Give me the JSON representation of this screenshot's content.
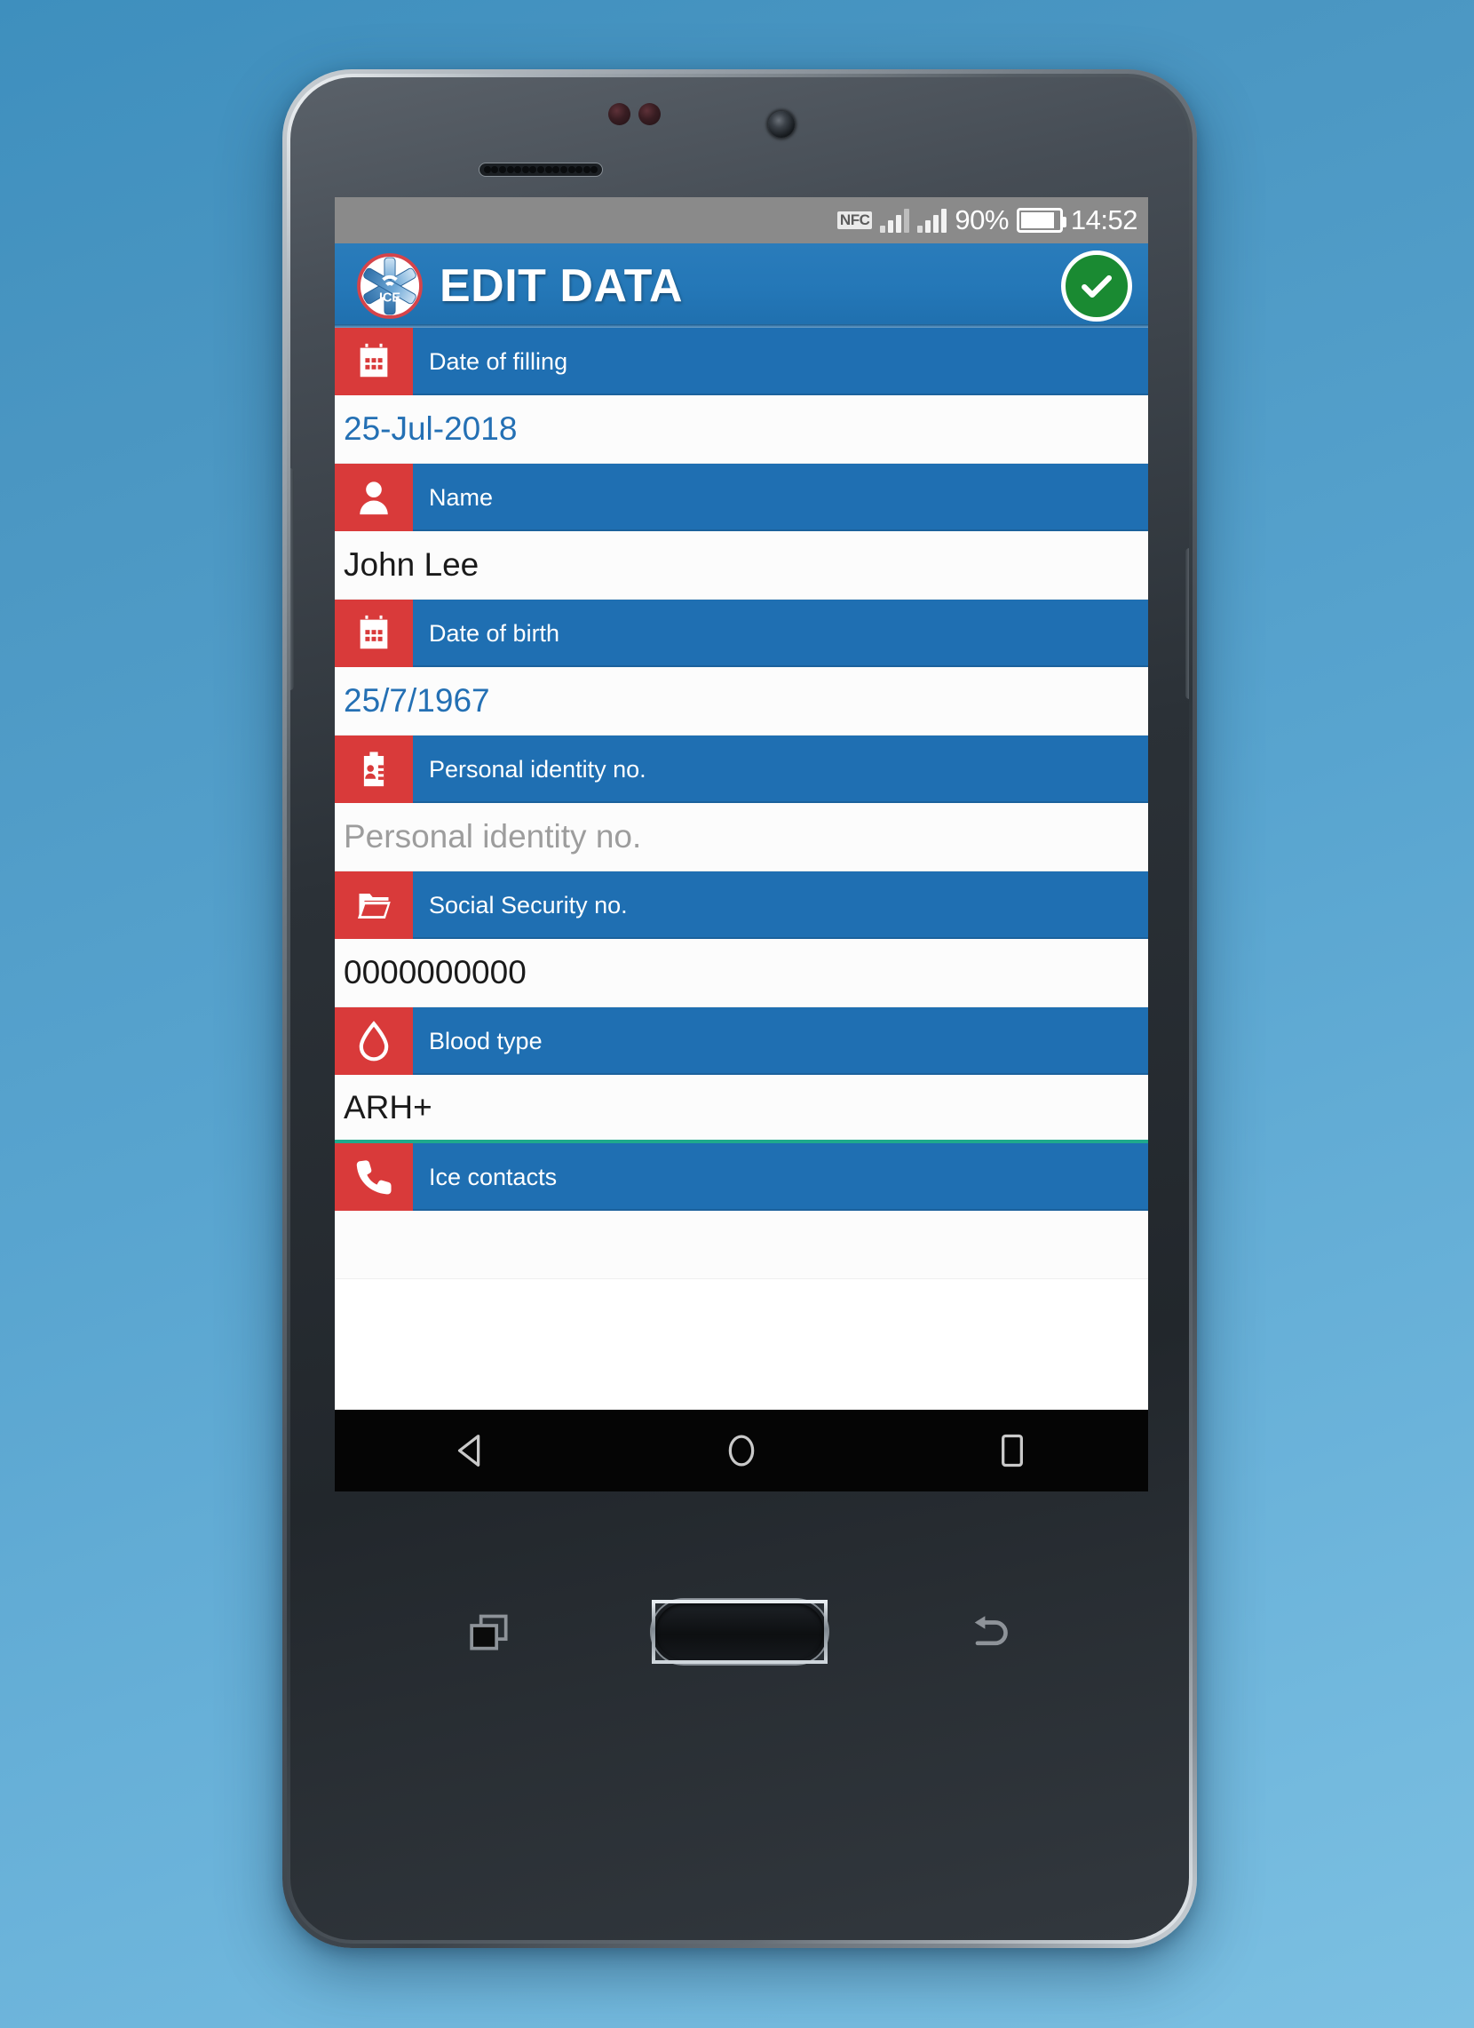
{
  "device": {
    "name": "android-smartphone",
    "earpiece": "earpiece-speaker",
    "front_camera": "front-camera",
    "hardware_buttons": [
      {
        "name": "recents-hardware-button",
        "icon": "recents-icon"
      },
      {
        "name": "home-hardware-button",
        "icon": "home-pill"
      },
      {
        "name": "back-hardware-button",
        "icon": "back-arrow-icon"
      }
    ]
  },
  "statusbar": {
    "nfc_label": "NFC",
    "signal_1": "signal-bars-icon",
    "signal_2": "signal-bars-icon",
    "battery_percent": "90%",
    "battery_icon": "battery-icon",
    "clock": "14:52"
  },
  "appbar": {
    "logo": "ice-star-of-life-logo",
    "title": "EDIT DATA",
    "save_label": "save-check-button",
    "accent_blue": "#2477b7",
    "save_green": "#1a8a32"
  },
  "form": {
    "icon_red": "#d93a3a",
    "label_blue": "#1f6fb2",
    "focus_teal": "#1fa98c",
    "fields": [
      {
        "icon": "calendar-icon",
        "label": "Date of filling",
        "value": "25-Jul-2018",
        "style": "blue",
        "is_placeholder": false
      },
      {
        "icon": "person-icon",
        "label": "Name",
        "value": "John Lee",
        "style": "plain",
        "is_placeholder": false
      },
      {
        "icon": "calendar-icon",
        "label": "Date of birth",
        "value": "25/7/1967",
        "style": "blue",
        "is_placeholder": false
      },
      {
        "icon": "id-card-icon",
        "label": "Personal identity no.",
        "value": "Personal identity no.",
        "style": "muted",
        "is_placeholder": true
      },
      {
        "icon": "folder-icon",
        "label": "Social Security no.",
        "value": "0000000000",
        "style": "plain",
        "is_placeholder": false
      },
      {
        "icon": "blood-drop-icon",
        "label": "Blood type",
        "value": "ARH+",
        "style": "focused",
        "is_placeholder": false
      },
      {
        "icon": "phone-icon",
        "label": "Ice contacts",
        "value": "",
        "style": "plain",
        "is_placeholder": false
      }
    ]
  },
  "navbar": {
    "back": "back-nav-icon",
    "home": "home-nav-icon",
    "recents": "recents-nav-icon"
  }
}
